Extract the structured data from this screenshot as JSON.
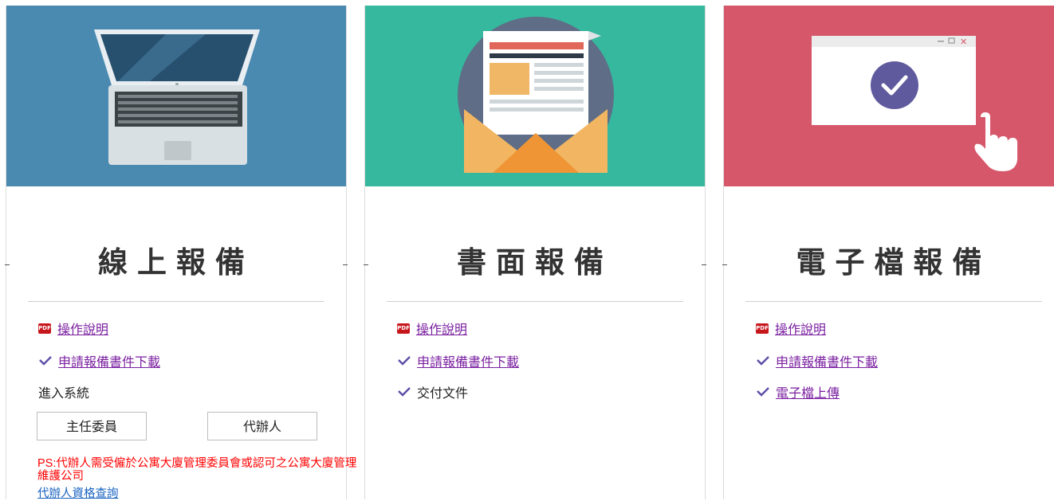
{
  "colors": {
    "card1_bg": "#4a8ab0",
    "card2_bg": "#36b89e",
    "card3_bg": "#d6566a",
    "link": "#7a1fa0",
    "check": "#5b4fa8",
    "pdf": "#c8161d",
    "ps_text": "#ff0000",
    "query_link": "#1560c0"
  },
  "cards": [
    {
      "title": "線上報備",
      "illustration": "laptop-icon",
      "items": [
        {
          "icon": "pdf-icon",
          "label": "操作說明",
          "link": true
        },
        {
          "icon": "check-icon",
          "label": "申請報備書件下載",
          "link": true
        },
        {
          "icon": "",
          "label": "進入系統",
          "link": false
        }
      ],
      "buttons": [
        "主任委員",
        "代辦人"
      ],
      "note": "PS:代辦人需受僱於公寓大廈管理委員會或認可之公寓大廈管理維護公司",
      "note_link": "代辦人資格查詢"
    },
    {
      "title": "書面報備",
      "illustration": "envelope-document-icon",
      "items": [
        {
          "icon": "pdf-icon",
          "label": "操作說明",
          "link": true
        },
        {
          "icon": "check-icon",
          "label": "申請報備書件下載",
          "link": true
        },
        {
          "icon": "check-icon",
          "label": "交付文件",
          "link": false
        }
      ]
    },
    {
      "title": "電子檔報備",
      "illustration": "window-check-click-icon",
      "items": [
        {
          "icon": "pdf-icon",
          "label": "操作說明",
          "link": true
        },
        {
          "icon": "check-icon",
          "label": "申請報備書件下載",
          "link": true
        },
        {
          "icon": "check-icon",
          "label": "電子檔上傳",
          "link": true
        }
      ]
    }
  ]
}
